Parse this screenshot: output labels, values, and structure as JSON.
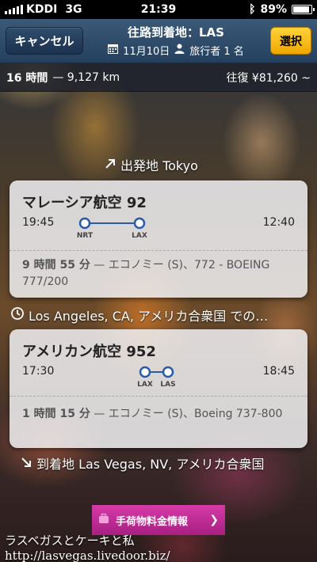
{
  "status_bar": {
    "carrier": "KDDI",
    "network": "3G",
    "time": "21:39",
    "battery": "89%",
    "battery_level": 0.89
  },
  "nav": {
    "cancel_label": "キャンセル",
    "title": "往路到着地：LAS",
    "date": "11月10日",
    "travelers": "旅行者 1 名",
    "select_label": "選択"
  },
  "summary": {
    "duration": "16 時間",
    "distance": "— 9,127 km",
    "price_label": "往復 ¥81,260 ~"
  },
  "origin": "出発地 Tokyo",
  "flights": [
    {
      "airline": "マレーシア航空 92",
      "dep_time": "19:45",
      "arr_time": "12:40",
      "from": "NRT",
      "to": "LAX",
      "duration": "9 時間 55 分",
      "details": " — エコノミー (S)、772 - BOEING 777/200"
    },
    {
      "airline": "アメリカン航空 952",
      "dep_time": "17:30",
      "arr_time": "18:45",
      "from": "LAX",
      "to": "LAS",
      "duration": "1 時間 15 分",
      "details": " — エコノミー (S)、Boeing 737-800"
    }
  ],
  "layover": "Los Angeles, CA, アメリカ合衆国 での…",
  "destination": "到着地 Las Vegas, NV, アメリカ合衆国",
  "promo_label": "手荷物料金情報",
  "overlay": {
    "line1": "ラスベガスとケーキと私",
    "line2": "http://lasvegas.livedoor.biz/"
  },
  "colors": {
    "nav": "#2e4c6c",
    "select": "#f5b800",
    "promo": "#c42d96",
    "route": "#2a5aa8"
  }
}
